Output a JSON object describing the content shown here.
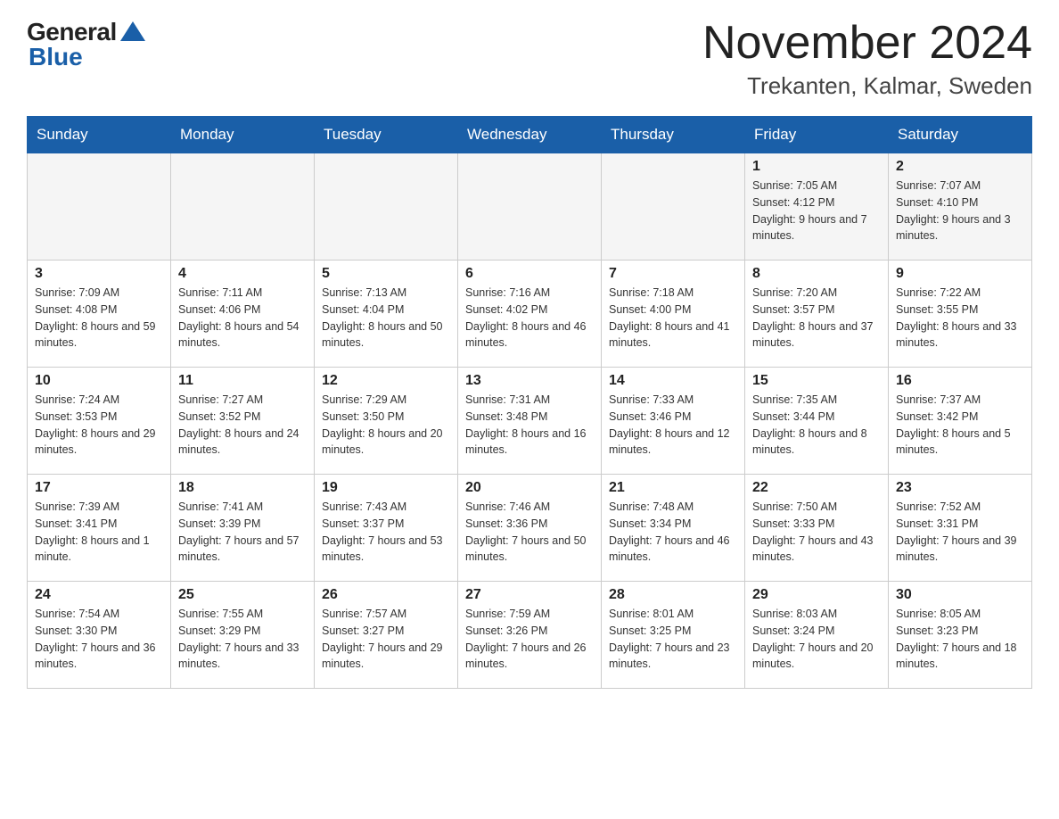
{
  "header": {
    "logo_general": "General",
    "logo_blue": "Blue",
    "month_title": "November 2024",
    "location": "Trekanten, Kalmar, Sweden"
  },
  "calendar": {
    "days_of_week": [
      "Sunday",
      "Monday",
      "Tuesday",
      "Wednesday",
      "Thursday",
      "Friday",
      "Saturday"
    ],
    "weeks": [
      [
        {
          "day": "",
          "info": ""
        },
        {
          "day": "",
          "info": ""
        },
        {
          "day": "",
          "info": ""
        },
        {
          "day": "",
          "info": ""
        },
        {
          "day": "",
          "info": ""
        },
        {
          "day": "1",
          "info": "Sunrise: 7:05 AM\nSunset: 4:12 PM\nDaylight: 9 hours and 7 minutes."
        },
        {
          "day": "2",
          "info": "Sunrise: 7:07 AM\nSunset: 4:10 PM\nDaylight: 9 hours and 3 minutes."
        }
      ],
      [
        {
          "day": "3",
          "info": "Sunrise: 7:09 AM\nSunset: 4:08 PM\nDaylight: 8 hours and 59 minutes."
        },
        {
          "day": "4",
          "info": "Sunrise: 7:11 AM\nSunset: 4:06 PM\nDaylight: 8 hours and 54 minutes."
        },
        {
          "day": "5",
          "info": "Sunrise: 7:13 AM\nSunset: 4:04 PM\nDaylight: 8 hours and 50 minutes."
        },
        {
          "day": "6",
          "info": "Sunrise: 7:16 AM\nSunset: 4:02 PM\nDaylight: 8 hours and 46 minutes."
        },
        {
          "day": "7",
          "info": "Sunrise: 7:18 AM\nSunset: 4:00 PM\nDaylight: 8 hours and 41 minutes."
        },
        {
          "day": "8",
          "info": "Sunrise: 7:20 AM\nSunset: 3:57 PM\nDaylight: 8 hours and 37 minutes."
        },
        {
          "day": "9",
          "info": "Sunrise: 7:22 AM\nSunset: 3:55 PM\nDaylight: 8 hours and 33 minutes."
        }
      ],
      [
        {
          "day": "10",
          "info": "Sunrise: 7:24 AM\nSunset: 3:53 PM\nDaylight: 8 hours and 29 minutes."
        },
        {
          "day": "11",
          "info": "Sunrise: 7:27 AM\nSunset: 3:52 PM\nDaylight: 8 hours and 24 minutes."
        },
        {
          "day": "12",
          "info": "Sunrise: 7:29 AM\nSunset: 3:50 PM\nDaylight: 8 hours and 20 minutes."
        },
        {
          "day": "13",
          "info": "Sunrise: 7:31 AM\nSunset: 3:48 PM\nDaylight: 8 hours and 16 minutes."
        },
        {
          "day": "14",
          "info": "Sunrise: 7:33 AM\nSunset: 3:46 PM\nDaylight: 8 hours and 12 minutes."
        },
        {
          "day": "15",
          "info": "Sunrise: 7:35 AM\nSunset: 3:44 PM\nDaylight: 8 hours and 8 minutes."
        },
        {
          "day": "16",
          "info": "Sunrise: 7:37 AM\nSunset: 3:42 PM\nDaylight: 8 hours and 5 minutes."
        }
      ],
      [
        {
          "day": "17",
          "info": "Sunrise: 7:39 AM\nSunset: 3:41 PM\nDaylight: 8 hours and 1 minute."
        },
        {
          "day": "18",
          "info": "Sunrise: 7:41 AM\nSunset: 3:39 PM\nDaylight: 7 hours and 57 minutes."
        },
        {
          "day": "19",
          "info": "Sunrise: 7:43 AM\nSunset: 3:37 PM\nDaylight: 7 hours and 53 minutes."
        },
        {
          "day": "20",
          "info": "Sunrise: 7:46 AM\nSunset: 3:36 PM\nDaylight: 7 hours and 50 minutes."
        },
        {
          "day": "21",
          "info": "Sunrise: 7:48 AM\nSunset: 3:34 PM\nDaylight: 7 hours and 46 minutes."
        },
        {
          "day": "22",
          "info": "Sunrise: 7:50 AM\nSunset: 3:33 PM\nDaylight: 7 hours and 43 minutes."
        },
        {
          "day": "23",
          "info": "Sunrise: 7:52 AM\nSunset: 3:31 PM\nDaylight: 7 hours and 39 minutes."
        }
      ],
      [
        {
          "day": "24",
          "info": "Sunrise: 7:54 AM\nSunset: 3:30 PM\nDaylight: 7 hours and 36 minutes."
        },
        {
          "day": "25",
          "info": "Sunrise: 7:55 AM\nSunset: 3:29 PM\nDaylight: 7 hours and 33 minutes."
        },
        {
          "day": "26",
          "info": "Sunrise: 7:57 AM\nSunset: 3:27 PM\nDaylight: 7 hours and 29 minutes."
        },
        {
          "day": "27",
          "info": "Sunrise: 7:59 AM\nSunset: 3:26 PM\nDaylight: 7 hours and 26 minutes."
        },
        {
          "day": "28",
          "info": "Sunrise: 8:01 AM\nSunset: 3:25 PM\nDaylight: 7 hours and 23 minutes."
        },
        {
          "day": "29",
          "info": "Sunrise: 8:03 AM\nSunset: 3:24 PM\nDaylight: 7 hours and 20 minutes."
        },
        {
          "day": "30",
          "info": "Sunrise: 8:05 AM\nSunset: 3:23 PM\nDaylight: 7 hours and 18 minutes."
        }
      ]
    ]
  }
}
